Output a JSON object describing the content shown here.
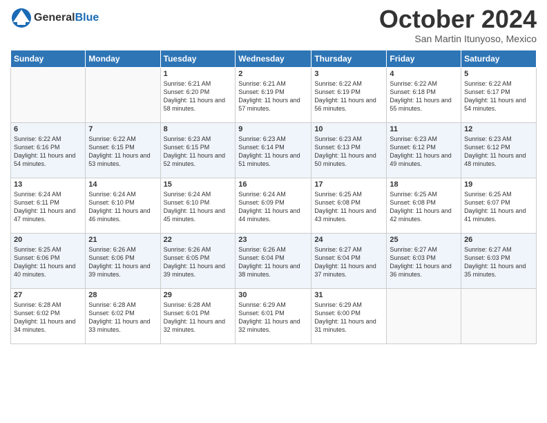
{
  "header": {
    "logo_general": "General",
    "logo_blue": "Blue",
    "month_title": "October 2024",
    "location": "San Martin Itunyoso, Mexico"
  },
  "weekdays": [
    "Sunday",
    "Monday",
    "Tuesday",
    "Wednesday",
    "Thursday",
    "Friday",
    "Saturday"
  ],
  "weeks": [
    [
      {
        "day": "",
        "sunrise": "",
        "sunset": "",
        "daylight": ""
      },
      {
        "day": "",
        "sunrise": "",
        "sunset": "",
        "daylight": ""
      },
      {
        "day": "1",
        "sunrise": "Sunrise: 6:21 AM",
        "sunset": "Sunset: 6:20 PM",
        "daylight": "Daylight: 11 hours and 58 minutes."
      },
      {
        "day": "2",
        "sunrise": "Sunrise: 6:21 AM",
        "sunset": "Sunset: 6:19 PM",
        "daylight": "Daylight: 11 hours and 57 minutes."
      },
      {
        "day": "3",
        "sunrise": "Sunrise: 6:22 AM",
        "sunset": "Sunset: 6:19 PM",
        "daylight": "Daylight: 11 hours and 56 minutes."
      },
      {
        "day": "4",
        "sunrise": "Sunrise: 6:22 AM",
        "sunset": "Sunset: 6:18 PM",
        "daylight": "Daylight: 11 hours and 55 minutes."
      },
      {
        "day": "5",
        "sunrise": "Sunrise: 6:22 AM",
        "sunset": "Sunset: 6:17 PM",
        "daylight": "Daylight: 11 hours and 54 minutes."
      }
    ],
    [
      {
        "day": "6",
        "sunrise": "Sunrise: 6:22 AM",
        "sunset": "Sunset: 6:16 PM",
        "daylight": "Daylight: 11 hours and 54 minutes."
      },
      {
        "day": "7",
        "sunrise": "Sunrise: 6:22 AM",
        "sunset": "Sunset: 6:15 PM",
        "daylight": "Daylight: 11 hours and 53 minutes."
      },
      {
        "day": "8",
        "sunrise": "Sunrise: 6:23 AM",
        "sunset": "Sunset: 6:15 PM",
        "daylight": "Daylight: 11 hours and 52 minutes."
      },
      {
        "day": "9",
        "sunrise": "Sunrise: 6:23 AM",
        "sunset": "Sunset: 6:14 PM",
        "daylight": "Daylight: 11 hours and 51 minutes."
      },
      {
        "day": "10",
        "sunrise": "Sunrise: 6:23 AM",
        "sunset": "Sunset: 6:13 PM",
        "daylight": "Daylight: 11 hours and 50 minutes."
      },
      {
        "day": "11",
        "sunrise": "Sunrise: 6:23 AM",
        "sunset": "Sunset: 6:12 PM",
        "daylight": "Daylight: 11 hours and 49 minutes."
      },
      {
        "day": "12",
        "sunrise": "Sunrise: 6:23 AM",
        "sunset": "Sunset: 6:12 PM",
        "daylight": "Daylight: 11 hours and 48 minutes."
      }
    ],
    [
      {
        "day": "13",
        "sunrise": "Sunrise: 6:24 AM",
        "sunset": "Sunset: 6:11 PM",
        "daylight": "Daylight: 11 hours and 47 minutes."
      },
      {
        "day": "14",
        "sunrise": "Sunrise: 6:24 AM",
        "sunset": "Sunset: 6:10 PM",
        "daylight": "Daylight: 11 hours and 46 minutes."
      },
      {
        "day": "15",
        "sunrise": "Sunrise: 6:24 AM",
        "sunset": "Sunset: 6:10 PM",
        "daylight": "Daylight: 11 hours and 45 minutes."
      },
      {
        "day": "16",
        "sunrise": "Sunrise: 6:24 AM",
        "sunset": "Sunset: 6:09 PM",
        "daylight": "Daylight: 11 hours and 44 minutes."
      },
      {
        "day": "17",
        "sunrise": "Sunrise: 6:25 AM",
        "sunset": "Sunset: 6:08 PM",
        "daylight": "Daylight: 11 hours and 43 minutes."
      },
      {
        "day": "18",
        "sunrise": "Sunrise: 6:25 AM",
        "sunset": "Sunset: 6:08 PM",
        "daylight": "Daylight: 11 hours and 42 minutes."
      },
      {
        "day": "19",
        "sunrise": "Sunrise: 6:25 AM",
        "sunset": "Sunset: 6:07 PM",
        "daylight": "Daylight: 11 hours and 41 minutes."
      }
    ],
    [
      {
        "day": "20",
        "sunrise": "Sunrise: 6:25 AM",
        "sunset": "Sunset: 6:06 PM",
        "daylight": "Daylight: 11 hours and 40 minutes."
      },
      {
        "day": "21",
        "sunrise": "Sunrise: 6:26 AM",
        "sunset": "Sunset: 6:06 PM",
        "daylight": "Daylight: 11 hours and 39 minutes."
      },
      {
        "day": "22",
        "sunrise": "Sunrise: 6:26 AM",
        "sunset": "Sunset: 6:05 PM",
        "daylight": "Daylight: 11 hours and 39 minutes."
      },
      {
        "day": "23",
        "sunrise": "Sunrise: 6:26 AM",
        "sunset": "Sunset: 6:04 PM",
        "daylight": "Daylight: 11 hours and 38 minutes."
      },
      {
        "day": "24",
        "sunrise": "Sunrise: 6:27 AM",
        "sunset": "Sunset: 6:04 PM",
        "daylight": "Daylight: 11 hours and 37 minutes."
      },
      {
        "day": "25",
        "sunrise": "Sunrise: 6:27 AM",
        "sunset": "Sunset: 6:03 PM",
        "daylight": "Daylight: 11 hours and 36 minutes."
      },
      {
        "day": "26",
        "sunrise": "Sunrise: 6:27 AM",
        "sunset": "Sunset: 6:03 PM",
        "daylight": "Daylight: 11 hours and 35 minutes."
      }
    ],
    [
      {
        "day": "27",
        "sunrise": "Sunrise: 6:28 AM",
        "sunset": "Sunset: 6:02 PM",
        "daylight": "Daylight: 11 hours and 34 minutes."
      },
      {
        "day": "28",
        "sunrise": "Sunrise: 6:28 AM",
        "sunset": "Sunset: 6:02 PM",
        "daylight": "Daylight: 11 hours and 33 minutes."
      },
      {
        "day": "29",
        "sunrise": "Sunrise: 6:28 AM",
        "sunset": "Sunset: 6:01 PM",
        "daylight": "Daylight: 11 hours and 32 minutes."
      },
      {
        "day": "30",
        "sunrise": "Sunrise: 6:29 AM",
        "sunset": "Sunset: 6:01 PM",
        "daylight": "Daylight: 11 hours and 32 minutes."
      },
      {
        "day": "31",
        "sunrise": "Sunrise: 6:29 AM",
        "sunset": "Sunset: 6:00 PM",
        "daylight": "Daylight: 11 hours and 31 minutes."
      },
      {
        "day": "",
        "sunrise": "",
        "sunset": "",
        "daylight": ""
      },
      {
        "day": "",
        "sunrise": "",
        "sunset": "",
        "daylight": ""
      }
    ]
  ]
}
